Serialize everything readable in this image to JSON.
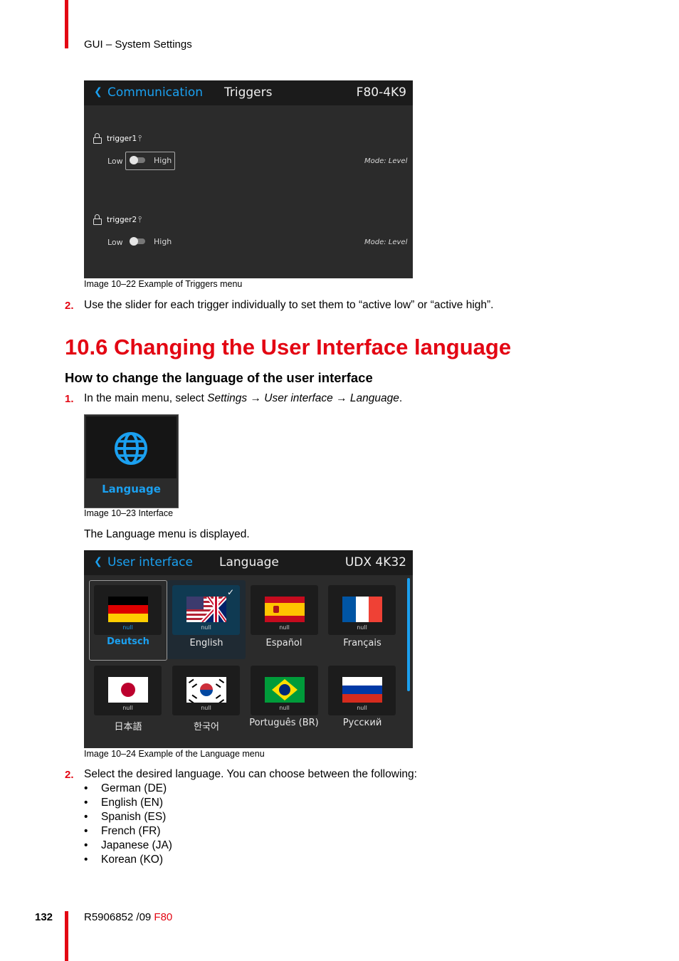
{
  "header": {
    "section": "GUI – System Settings"
  },
  "triggers_screen": {
    "back_icon": "chevron-left-icon",
    "breadcrumb": "Communication",
    "title": "Triggers",
    "model": "F80-4K9",
    "triggers": [
      {
        "name": "trigger1",
        "low": "Low",
        "high": "High",
        "mode": "Mode: Level"
      },
      {
        "name": "trigger2",
        "low": "Low",
        "high": "High",
        "mode": "Mode: Level"
      }
    ]
  },
  "caption_22": "Image 10–22  Example of Triggers menu",
  "step2_triggers": {
    "number": "2.",
    "text": "Use the slider for each trigger individually to set them to “active low” or “active high”."
  },
  "section": {
    "title": "10.6 Changing the User Interface language",
    "subtitle": "How to change the language of the user interface"
  },
  "step1": {
    "number": "1.",
    "prefix": "In the main menu, select ",
    "path": "Settings → User interface → Language",
    "suffix": "."
  },
  "language_tile": {
    "label": "Language",
    "icon": "globe-icon"
  },
  "caption_23": "Image 10–23  Interface",
  "language_displayed": "The Language menu is displayed.",
  "language_screen": {
    "back_icon": "chevron-left-icon",
    "breadcrumb": "User interface",
    "title": "Language",
    "model": "UDX 4K32",
    "placeholder": "null",
    "languages": [
      "Deutsch",
      "English",
      "Español",
      "Français",
      "日本語",
      "한국어",
      "Português (BR)",
      "Русский"
    ],
    "selected": "Deutsch",
    "checked": "English"
  },
  "caption_24": "Image 10–24  Example of the Language menu",
  "step2_lang": {
    "number": "2.",
    "text": "Select the desired language. You can choose between the following:"
  },
  "language_list": [
    "German (DE)",
    "English (EN)",
    "Spanish (ES)",
    "French (FR)",
    "Japanese (JA)",
    "Korean (KO)"
  ],
  "footer": {
    "page": "132",
    "doc": "R5906852 /09",
    "product": "F80"
  },
  "colors": {
    "brand_red": "#e30613",
    "accent_blue": "#1ba0f0",
    "panel_bg": "#2b2b2b"
  }
}
